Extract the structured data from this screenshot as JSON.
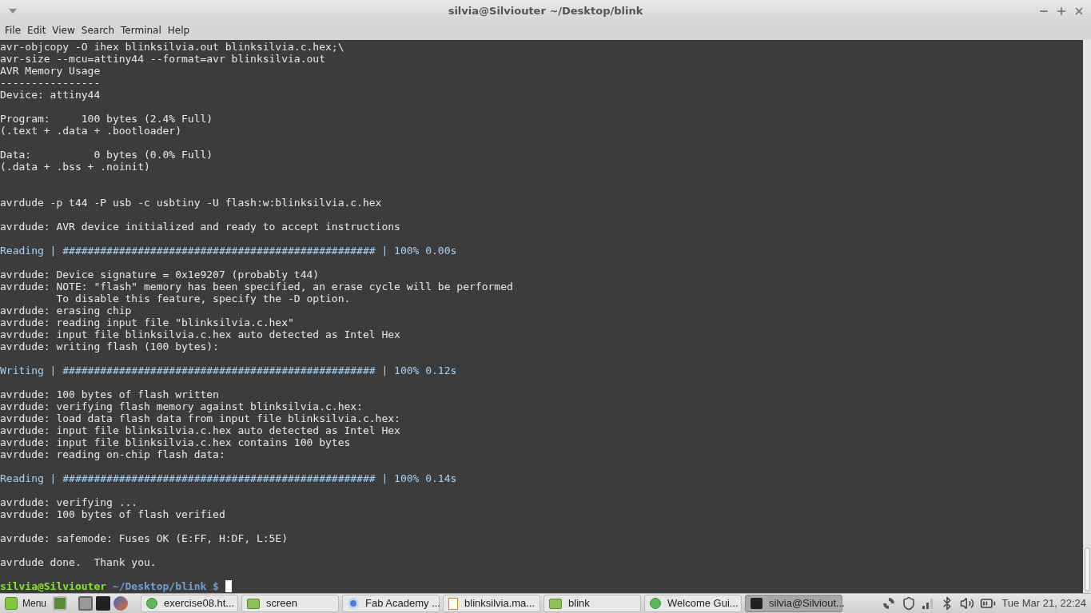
{
  "window": {
    "title": "silvia@Silviouter ~/Desktop/blink"
  },
  "menu": [
    "File",
    "Edit",
    "View",
    "Search",
    "Terminal",
    "Help"
  ],
  "terminal": {
    "lines": [
      {
        "kind": "text",
        "text": "avr-objcopy -O ihex blinksilvia.out blinksilvia.c.hex;\\"
      },
      {
        "kind": "text",
        "text": "avr-size --mcu=attiny44 --format=avr blinksilvia.out"
      },
      {
        "kind": "text",
        "text": "AVR Memory Usage"
      },
      {
        "kind": "text",
        "text": "----------------"
      },
      {
        "kind": "text",
        "text": "Device: attiny44"
      },
      {
        "kind": "blank"
      },
      {
        "kind": "text",
        "text": "Program:     100 bytes (2.4% Full)"
      },
      {
        "kind": "text",
        "text": "(.text + .data + .bootloader)"
      },
      {
        "kind": "blank"
      },
      {
        "kind": "text",
        "text": "Data:          0 bytes (0.0% Full)"
      },
      {
        "kind": "text",
        "text": "(.data + .bss + .noinit)"
      },
      {
        "kind": "blank"
      },
      {
        "kind": "blank"
      },
      {
        "kind": "text",
        "text": "avrdude -p t44 -P usb -c usbtiny -U flash:w:blinksilvia.c.hex"
      },
      {
        "kind": "blank"
      },
      {
        "kind": "text",
        "text": "avrdude: AVR device initialized and ready to accept instructions"
      },
      {
        "kind": "blank"
      },
      {
        "kind": "progress",
        "text": "Reading | ################################################## | 100% 0.00s"
      },
      {
        "kind": "blank"
      },
      {
        "kind": "text",
        "text": "avrdude: Device signature = 0x1e9207 (probably t44)"
      },
      {
        "kind": "text",
        "text": "avrdude: NOTE: \"flash\" memory has been specified, an erase cycle will be performed"
      },
      {
        "kind": "text",
        "text": "         To disable this feature, specify the -D option."
      },
      {
        "kind": "text",
        "text": "avrdude: erasing chip"
      },
      {
        "kind": "text",
        "text": "avrdude: reading input file \"blinksilvia.c.hex\""
      },
      {
        "kind": "text",
        "text": "avrdude: input file blinksilvia.c.hex auto detected as Intel Hex"
      },
      {
        "kind": "text",
        "text": "avrdude: writing flash (100 bytes):"
      },
      {
        "kind": "blank"
      },
      {
        "kind": "progress",
        "text": "Writing | ################################################## | 100% 0.12s"
      },
      {
        "kind": "blank"
      },
      {
        "kind": "text",
        "text": "avrdude: 100 bytes of flash written"
      },
      {
        "kind": "text",
        "text": "avrdude: verifying flash memory against blinksilvia.c.hex:"
      },
      {
        "kind": "text",
        "text": "avrdude: load data flash data from input file blinksilvia.c.hex:"
      },
      {
        "kind": "text",
        "text": "avrdude: input file blinksilvia.c.hex auto detected as Intel Hex"
      },
      {
        "kind": "text",
        "text": "avrdude: input file blinksilvia.c.hex contains 100 bytes"
      },
      {
        "kind": "text",
        "text": "avrdude: reading on-chip flash data:"
      },
      {
        "kind": "blank"
      },
      {
        "kind": "progress",
        "text": "Reading | ################################################## | 100% 0.14s"
      },
      {
        "kind": "blank"
      },
      {
        "kind": "text",
        "text": "avrdude: verifying ..."
      },
      {
        "kind": "text",
        "text": "avrdude: 100 bytes of flash verified"
      },
      {
        "kind": "blank"
      },
      {
        "kind": "text",
        "text": "avrdude: safemode: Fuses OK (E:FF, H:DF, L:5E)"
      },
      {
        "kind": "blank"
      },
      {
        "kind": "text",
        "text": "avrdude done.  Thank you."
      },
      {
        "kind": "blank"
      }
    ],
    "prompt": {
      "user_host": "silvia@Silviouter",
      "path": "~/Desktop/blink $"
    }
  },
  "taskbar": {
    "menu_label": "Menu",
    "windows": [
      {
        "kind": "globe",
        "label": "exercise08.ht...",
        "selected": false
      },
      {
        "kind": "folder",
        "label": "screen",
        "selected": false
      },
      {
        "kind": "browser",
        "label": "Fab Academy ...",
        "selected": false
      },
      {
        "kind": "document",
        "label": "blinksilvia.ma...",
        "selected": false
      },
      {
        "kind": "folder",
        "label": "blink",
        "selected": false
      },
      {
        "kind": "globe",
        "label": "Welcome Gui...",
        "selected": false
      },
      {
        "kind": "terminal",
        "label": "silvia@Silviout...",
        "selected": true
      }
    ],
    "clock": "Tue Mar 21, 22:24"
  }
}
